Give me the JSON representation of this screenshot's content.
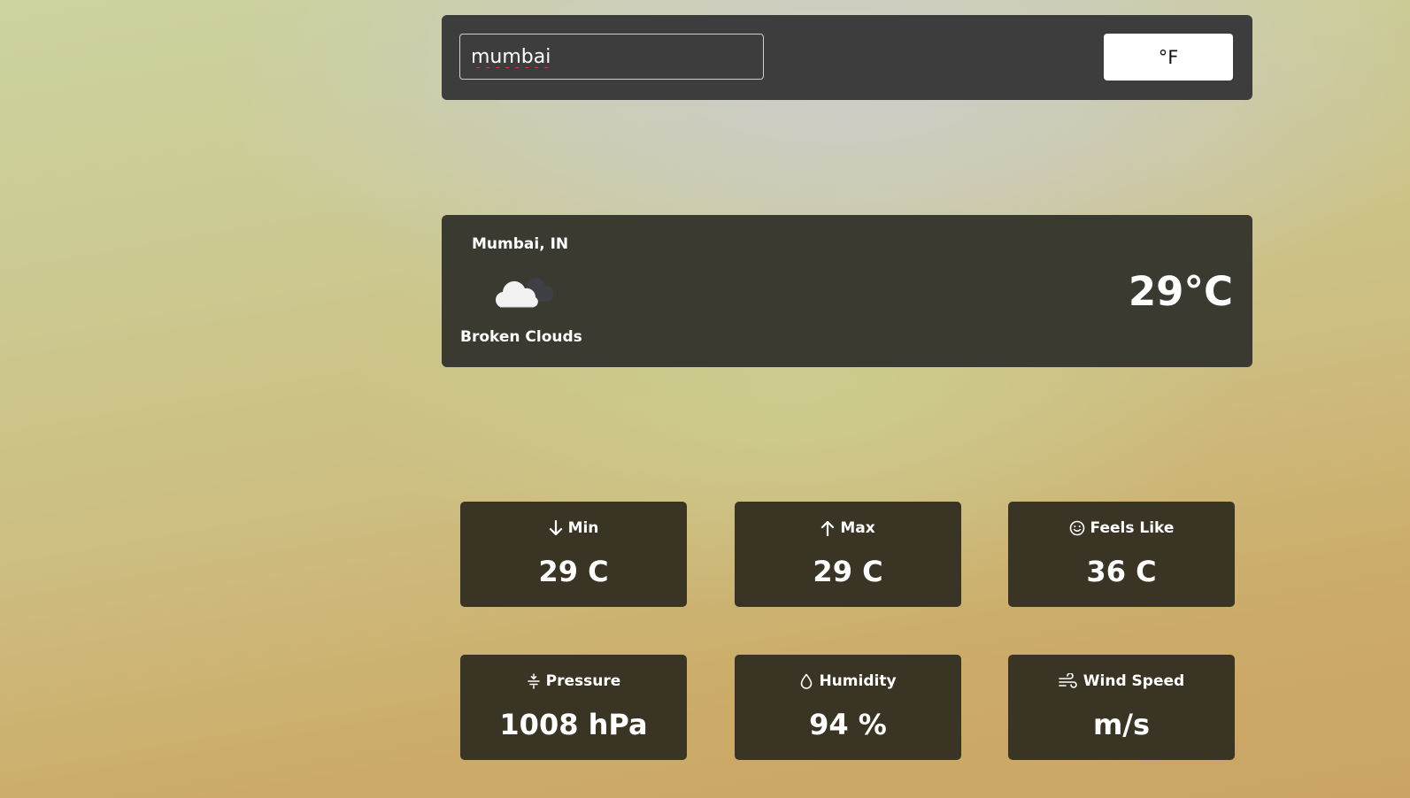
{
  "search": {
    "value": "mumbai"
  },
  "unit_toggle": {
    "label": "°F"
  },
  "current": {
    "city": "Mumbai, IN",
    "icon": "broken-clouds-icon",
    "condition": "Broken Clouds",
    "temperature": "29°C"
  },
  "stats": {
    "min": {
      "icon": "arrow-down-icon",
      "label": "Min",
      "value": "29 C"
    },
    "max": {
      "icon": "arrow-up-icon",
      "label": "Max",
      "value": "29 C"
    },
    "feels_like": {
      "icon": "smile-icon",
      "label": "Feels Like",
      "value": "36 C"
    },
    "pressure": {
      "icon": "pressure-icon",
      "label": "Pressure",
      "value": "1008 hPa"
    },
    "humidity": {
      "icon": "droplet-icon",
      "label": "Humidity",
      "value": "94 %"
    },
    "wind_speed": {
      "icon": "wind-icon",
      "label": "Wind Speed",
      "value": "m/s"
    }
  }
}
